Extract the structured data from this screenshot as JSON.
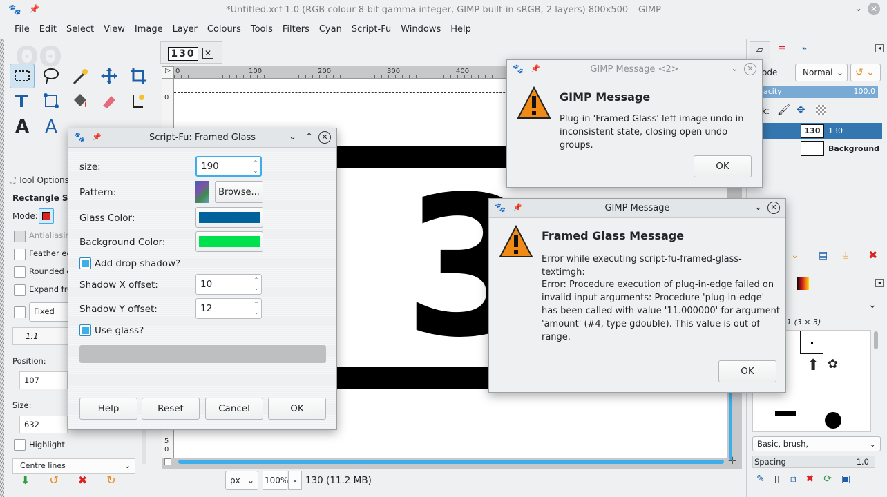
{
  "window": {
    "title": "*Untitled.xcf-1.0 (RGB colour 8-bit gamma integer, GIMP built-in sRGB, 2 layers) 800x500 – GIMP"
  },
  "menu": [
    "File",
    "Edit",
    "Select",
    "View",
    "Image",
    "Layer",
    "Colours",
    "Tools",
    "Filters",
    "Cyan",
    "Script-Fu",
    "Windows",
    "Help"
  ],
  "image_tab": {
    "thumb_text": "130"
  },
  "rulers": {
    "h": [
      "0",
      "100",
      "200",
      "300",
      "400"
    ],
    "v": [
      "0",
      "5",
      "0"
    ]
  },
  "tool_options": {
    "header": "Tool Options",
    "tool_name": "Rectangle Sele",
    "mode_label": "Mode:",
    "antialiasing": "Antialiasing",
    "feather": "Feather ed",
    "rounded": "Rounded c",
    "expand": "Expand fro",
    "fixed_label": "Fixed",
    "ratio": "1:1",
    "position_label": "Position:",
    "position_value": "107",
    "size_label": "Size:",
    "size_value": "632",
    "highlight": "Highlight",
    "guides": "Centre lines"
  },
  "status": {
    "unit": "px",
    "zoom": "100%",
    "info": "130 (11.2 MB)"
  },
  "layers_panel": {
    "mode_label": "ode",
    "mode_value": "Normal",
    "opacity_label": "acity",
    "opacity_value": "100.0",
    "lock_label": "k:",
    "layers": [
      {
        "thumb": "130",
        "name": "130"
      },
      {
        "thumb": "",
        "name": "Background"
      }
    ]
  },
  "brushes_panel": {
    "brush_title": "1 (3 × 3)",
    "preset": "Basic, brush,",
    "spacing_label": "Spacing",
    "spacing_value": "1.0"
  },
  "framed_glass": {
    "title": "Script-Fu: Framed Glass",
    "size_label": "size:",
    "size_value": "190",
    "pattern_label": "Pattern:",
    "browse": "Browse...",
    "glass_color_label": "Glass Color:",
    "glass_color": "#00619c",
    "bg_color_label": "Background Color:",
    "bg_color": "#00e24d",
    "drop_shadow": "Add drop shadow?",
    "shadow_x_label": "Shadow X offset:",
    "shadow_x": "10",
    "shadow_y_label": "Shadow Y offset:",
    "shadow_y": "12",
    "use_glass": "Use glass?",
    "buttons": {
      "help": "Help",
      "reset": "Reset",
      "cancel": "Cancel",
      "ok": "OK"
    }
  },
  "msg2": {
    "title": "GIMP Message <2>",
    "heading": "GIMP Message",
    "body": "Plug-in 'Framed Glass' left image undo in inconsistent state, closing open undo groups.",
    "ok": "OK"
  },
  "msg1": {
    "title": "GIMP Message",
    "heading": "Framed Glass Message",
    "line1": "Error while executing script-fu-framed-glass-textimgh:",
    "line2": "Error: Procedure execution of plug-in-edge failed on invalid input arguments: Procedure 'plug-in-edge' has been called with value '11.000000' for argument 'amount' (#4, type gdouble). This value is out of range.",
    "ok": "OK"
  },
  "canvas": {
    "digit": "3"
  }
}
